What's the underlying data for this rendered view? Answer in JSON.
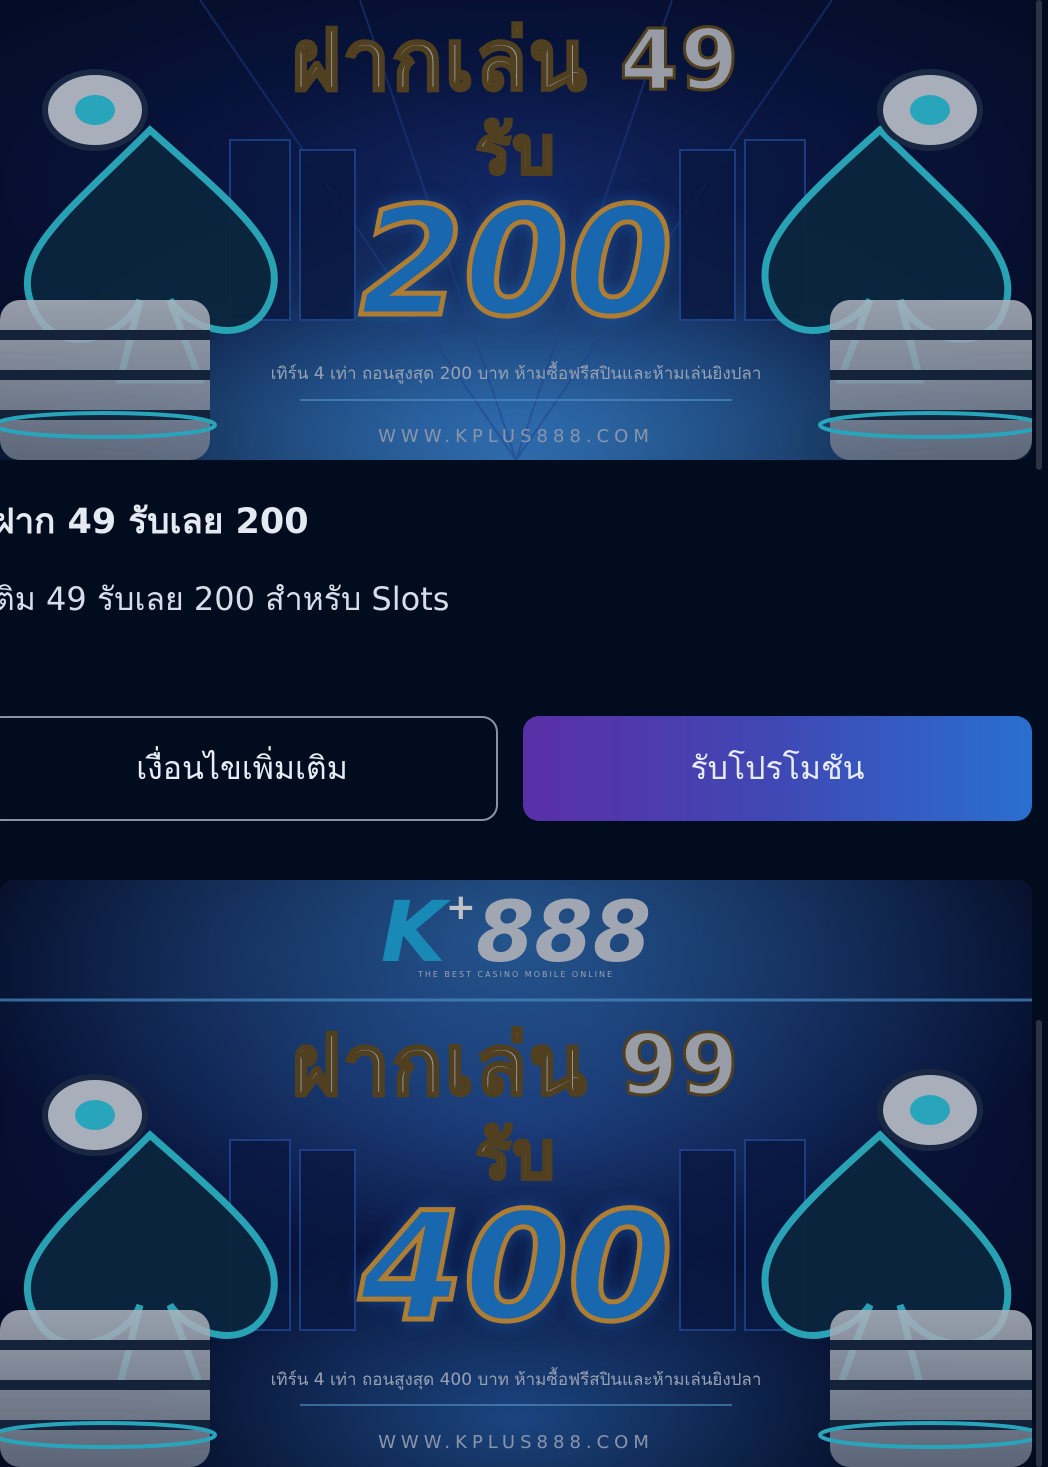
{
  "promo1": {
    "banner": {
      "heading": "ฝากเล่น 49",
      "receive": "รับ",
      "amount": "200",
      "fineprint": "เทิร์น 4 เท่า ถอนสูงสุด 200 บาท ห้ามซื้อฟรีสปินและห้ามเล่นยิงปลา",
      "url": "WWW.KPLUS888.COM"
    },
    "title": "ฝาก 49 รับเลย 200",
    "description": "ติม 49 รับเลย 200 สำหรับ Slots",
    "conditions_button": "เงื่อนไขเพิ่มเติม",
    "claim_button": "รับโปรโมชัน"
  },
  "promo2": {
    "banner": {
      "logo_k": "K",
      "logo_plus": "+",
      "logo_number": "888",
      "logo_tagline": "THE BEST CASINO MOBILE ONLINE",
      "heading": "ฝากเล่น 99",
      "receive": "รับ",
      "amount": "400",
      "fineprint": "เทิร์น 4 เท่า ถอนสูงสุด 400 บาท ห้ามซื้อฟรีสปินและห้ามเล่นยิงปลา",
      "url": "WWW.KPLUS888.COM"
    }
  },
  "colors": {
    "background": "#020c1f",
    "accent_gradient_start": "#5a2fa6",
    "accent_gradient_end": "#2a6fd0",
    "amount_fill": "#1f86e0",
    "amount_outline": "#e8a33a"
  }
}
